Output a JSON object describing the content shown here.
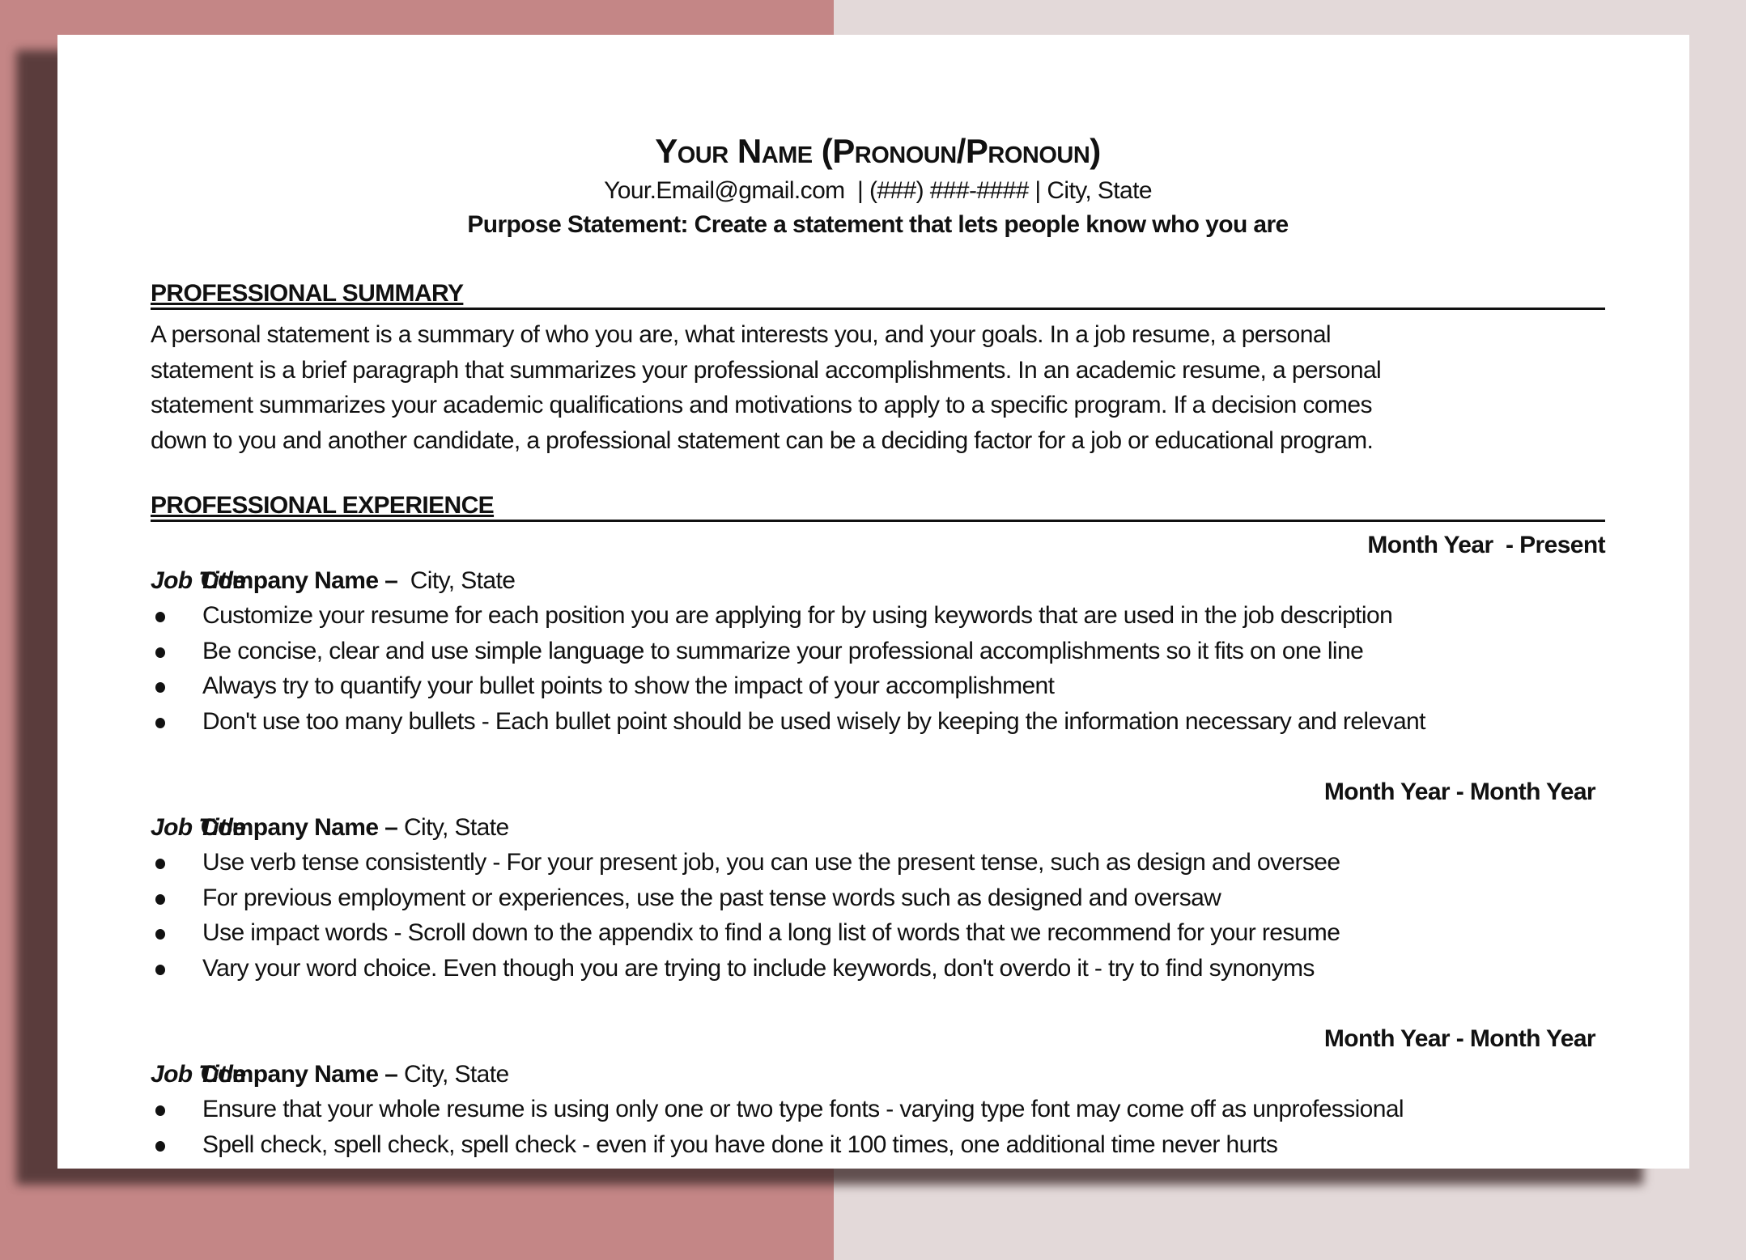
{
  "background": {
    "left_color": "#c48686",
    "right_color": "#e3d9d9",
    "paper_color": "#ffffff",
    "text_color": "#111111"
  },
  "header": {
    "name": "Your Name (Pronoun/Pronoun)",
    "contact": "Your.Email@gmail.com  | (###) ###-#### | City, State",
    "purpose": "Purpose Statement: Create a statement that lets people know who you are"
  },
  "summary": {
    "heading": "PROFESSIONAL SUMMARY",
    "lines": [
      "A personal statement is a summary of who you are, what interests you, and your goals. In a job resume, a personal",
      "statement is a brief paragraph that summarizes your professional accomplishments. In an academic resume, a personal",
      "statement summarizes your academic qualifications and motivations to apply to a specific program. If a decision comes",
      "down to you and another candidate, a professional statement can be a deciding factor for a job or educational program."
    ]
  },
  "experience": {
    "heading": "PROFESSIONAL EXPERIENCE",
    "entries": [
      {
        "company": "Company Name –",
        "location": "  City, State",
        "dates": "Month Year  - Present",
        "job_title": "Job Title",
        "bullets": [
          "Customize your resume for each position you are applying for by using keywords that are used in the job description",
          "Be concise, clear and use simple language to summarize your professional accomplishments so it fits on one line",
          "Always try to quantify your bullet points to show the impact of your accomplishment",
          "Don't use too many bullets - Each bullet point should be used wisely by keeping the information necessary and relevant"
        ]
      },
      {
        "company": "Company Name –",
        "location": " City, State",
        "dates": "Month Year - Month Year",
        "job_title": "Job Title",
        "bullets": [
          "Use verb tense consistently - For your present job, you can use the present tense, such as design and oversee",
          "For previous employment or experiences, use the past tense words such as designed and oversaw",
          "Use impact words - Scroll down to the appendix to find a long list of words that we recommend for your resume",
          "Vary your word choice. Even though you are trying to include keywords, don't overdo it - try to find synonyms"
        ]
      },
      {
        "company": "Company Name –",
        "location": " City, State",
        "dates": "Month Year - Month Year",
        "job_title": "Job Title",
        "bullets": [
          "Ensure that your whole resume is using only one or two type fonts - varying type font may come off as unprofessional",
          "Spell check, spell check, spell check - even if you have done it 100 times, one additional time never hurts",
          ""
        ]
      }
    ]
  }
}
